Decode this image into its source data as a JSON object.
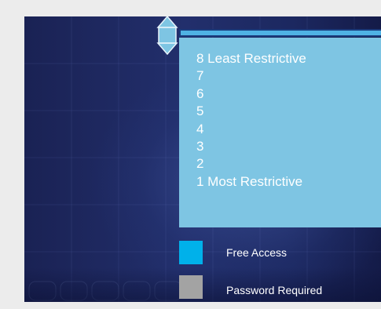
{
  "security_slider": {
    "levels": [
      {
        "level": 8,
        "label": "8 Least Restrictive"
      },
      {
        "level": 7,
        "label": "7"
      },
      {
        "level": 6,
        "label": "6"
      },
      {
        "level": 5,
        "label": "5"
      },
      {
        "level": 4,
        "label": "4"
      },
      {
        "level": 3,
        "label": "3"
      },
      {
        "level": 2,
        "label": "2"
      },
      {
        "level": 1,
        "label": "1 Most Restrictive"
      }
    ]
  },
  "legend": {
    "free_access": {
      "label": "Free Access",
      "color": "#00b1ea"
    },
    "password_required": {
      "label": "Password Required",
      "color": "#a3a3a3"
    }
  },
  "colors": {
    "list_background": "#7ec5e3",
    "slider_accent": "#4fb2e4",
    "panel_dark": "#1a2254"
  },
  "icons": {
    "slider_handle": "slider-handle-icon"
  }
}
